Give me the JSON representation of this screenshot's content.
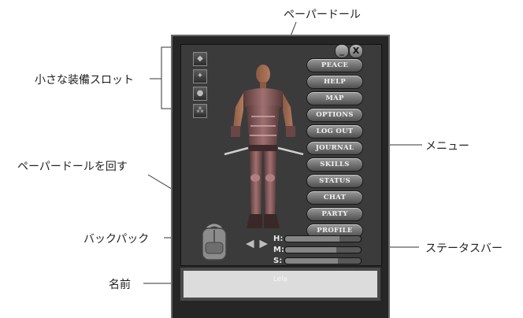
{
  "callouts": {
    "paperdoll": "ペーパードール",
    "small_slots": "小さな装備スロット",
    "menu": "メニュー",
    "rotate": "ペーパードールを回す",
    "backpack": "バックパック",
    "status_bars": "ステータスバー",
    "name": "名前"
  },
  "window": {
    "minimize_label": "_",
    "close_label": "X"
  },
  "menu_items": [
    "PEACE",
    "HELP",
    "MAP",
    "OPTIONS",
    "LOG OUT",
    "JOURNAL",
    "SKILLS",
    "STATUS",
    "CHAT",
    "PARTY",
    "PROFILE"
  ],
  "stats": [
    {
      "label": "H:",
      "fill": 0.72
    },
    {
      "label": "M:",
      "fill": 0.68
    },
    {
      "label": "S:",
      "fill": 0.7
    }
  ],
  "character_name": "Lela",
  "colors": {
    "window_bg": "#262626",
    "button": "#7a7a7a",
    "namebox": "#dcdcdc"
  }
}
